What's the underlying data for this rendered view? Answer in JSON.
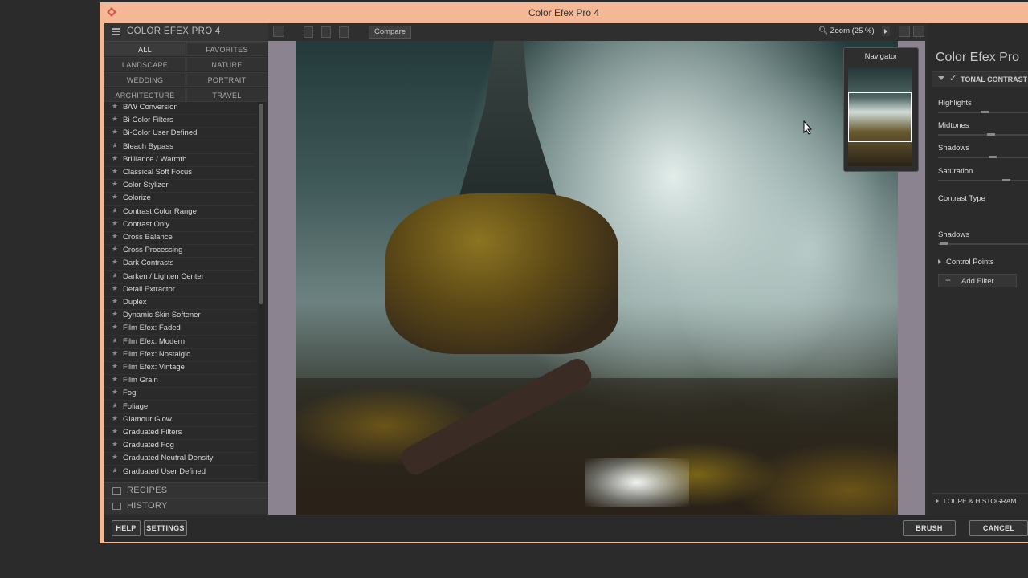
{
  "window": {
    "title": "Color Efex Pro 4"
  },
  "left_panel": {
    "header": "COLOR EFEX PRO 4",
    "categories": [
      "ALL",
      "FAVORITES",
      "LANDSCAPE",
      "NATURE",
      "WEDDING",
      "PORTRAIT",
      "ARCHITECTURE",
      "TRAVEL"
    ],
    "filters": [
      "B/W Conversion",
      "Bi-Color Filters",
      "Bi-Color User Defined",
      "Bleach Bypass",
      "Brilliance / Warmth",
      "Classical Soft Focus",
      "Color Stylizer",
      "Colorize",
      "Contrast Color Range",
      "Contrast Only",
      "Cross Balance",
      "Cross Processing",
      "Dark Contrasts",
      "Darken / Lighten Center",
      "Detail Extractor",
      "Duplex",
      "Dynamic Skin Softener",
      "Film Efex: Faded",
      "Film Efex: Modern",
      "Film Efex: Nostalgic",
      "Film Efex: Vintage",
      "Film Grain",
      "Fog",
      "Foliage",
      "Glamour Glow",
      "Graduated Filters",
      "Graduated Fog",
      "Graduated Neutral Density",
      "Graduated User Defined"
    ],
    "recipes": "RECIPES",
    "history": "HISTORY"
  },
  "toolbar": {
    "compare": "Compare",
    "zoom": "Zoom (25 %)"
  },
  "navigator": {
    "title": "Navigator"
  },
  "right_panel": {
    "title": "Color Efex Pro",
    "filter": "TONAL CONTRAST",
    "sliders": [
      {
        "label": "Highlights",
        "value": 0.52
      },
      {
        "label": "Midtones",
        "value": 0.6
      },
      {
        "label": "Shadows",
        "value": 0.62
      },
      {
        "label": "Saturation",
        "value": 0.78
      }
    ],
    "contrast_type": "Contrast Type",
    "shadows2": {
      "label": "Shadows",
      "value": 0.02
    },
    "control_points": "Control Points",
    "add_filter": "Add Filter",
    "loupe": "LOUPE & HISTOGRAM"
  },
  "bottom": {
    "help": "HELP",
    "settings": "SETTINGS",
    "brush": "BRUSH",
    "cancel": "CANCEL"
  }
}
